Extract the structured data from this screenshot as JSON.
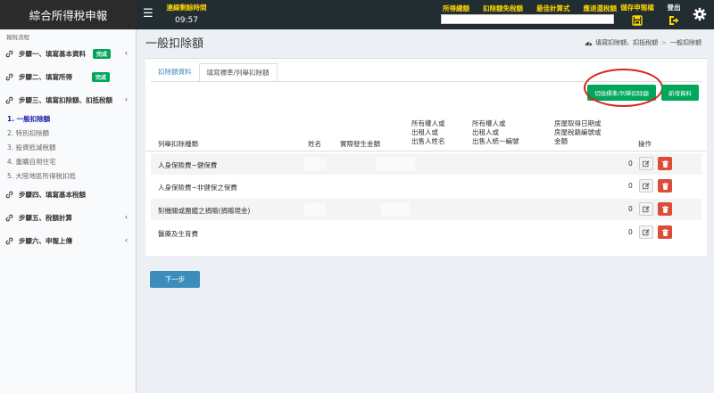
{
  "header": {
    "brand": "綜合所得稅申報",
    "countdown_label": "連線剩餘時間",
    "countdown_value": "09:57",
    "links": [
      "所得總額",
      "扣除額免稅額",
      "最佳計算式",
      "應退還稅額"
    ],
    "search_value": "",
    "save_label": "儲存申報檔",
    "logout_label": "登出"
  },
  "sidebar": {
    "caption": "報稅流程",
    "steps": [
      {
        "label": "步驟一、填寫基本資料",
        "badge": "完成"
      },
      {
        "label": "步驟二、填寫所得",
        "badge": "完成"
      },
      {
        "label": "步驟三、填寫扣除額、扣抵稅額",
        "badge": ""
      },
      {
        "label": "步驟四、填寫基本稅額",
        "badge": ""
      },
      {
        "label": "步驟五、稅額計算",
        "badge": ""
      },
      {
        "label": "步驟六、申報上傳",
        "badge": ""
      }
    ],
    "substeps": [
      "1. 一般扣除額",
      "2. 特別扣除額",
      "3. 投資抵減稅額",
      "4. 重購自用住宅",
      "5. 大陸地區所得稅扣抵"
    ]
  },
  "page": {
    "title": "一般扣除額",
    "breadcrumb": [
      "填寫扣除額、扣抵稅額",
      "一般扣除額"
    ]
  },
  "tabs": [
    "扣除額資料",
    "填寫標準/列舉扣除額"
  ],
  "buttons": {
    "switch": "切換標準/列舉扣除額",
    "add": "新增資料",
    "next": "下一步"
  },
  "table": {
    "headers": {
      "type": "列舉扣除種類",
      "name": "姓名",
      "amount": "實際發生金額",
      "owner_name": [
        "所有權人或",
        "出租人或",
        "出售人姓名"
      ],
      "owner_id": [
        "所有權人或",
        "出租人或",
        "出售人統一編號"
      ],
      "house": [
        "房屋取得日期或",
        "房屋稅籍編號或",
        "金額"
      ],
      "action": "操作"
    },
    "rows": [
      {
        "type": "人身保險費~健保費",
        "amount": "0"
      },
      {
        "type": "人身保險費~非健保之保費",
        "amount": "0"
      },
      {
        "type": "對機關或團體之捐贈(捐贈現金)",
        "amount": "0"
      },
      {
        "type": "醫藥及生育費",
        "amount": "0"
      }
    ]
  },
  "colors": {
    "topbar": "#222d32",
    "accent_yellow": "#ffd700",
    "success": "#00a65a",
    "danger": "#dd4b39",
    "primary": "#3c8dbc",
    "highlight_circle": "#d9231c"
  }
}
